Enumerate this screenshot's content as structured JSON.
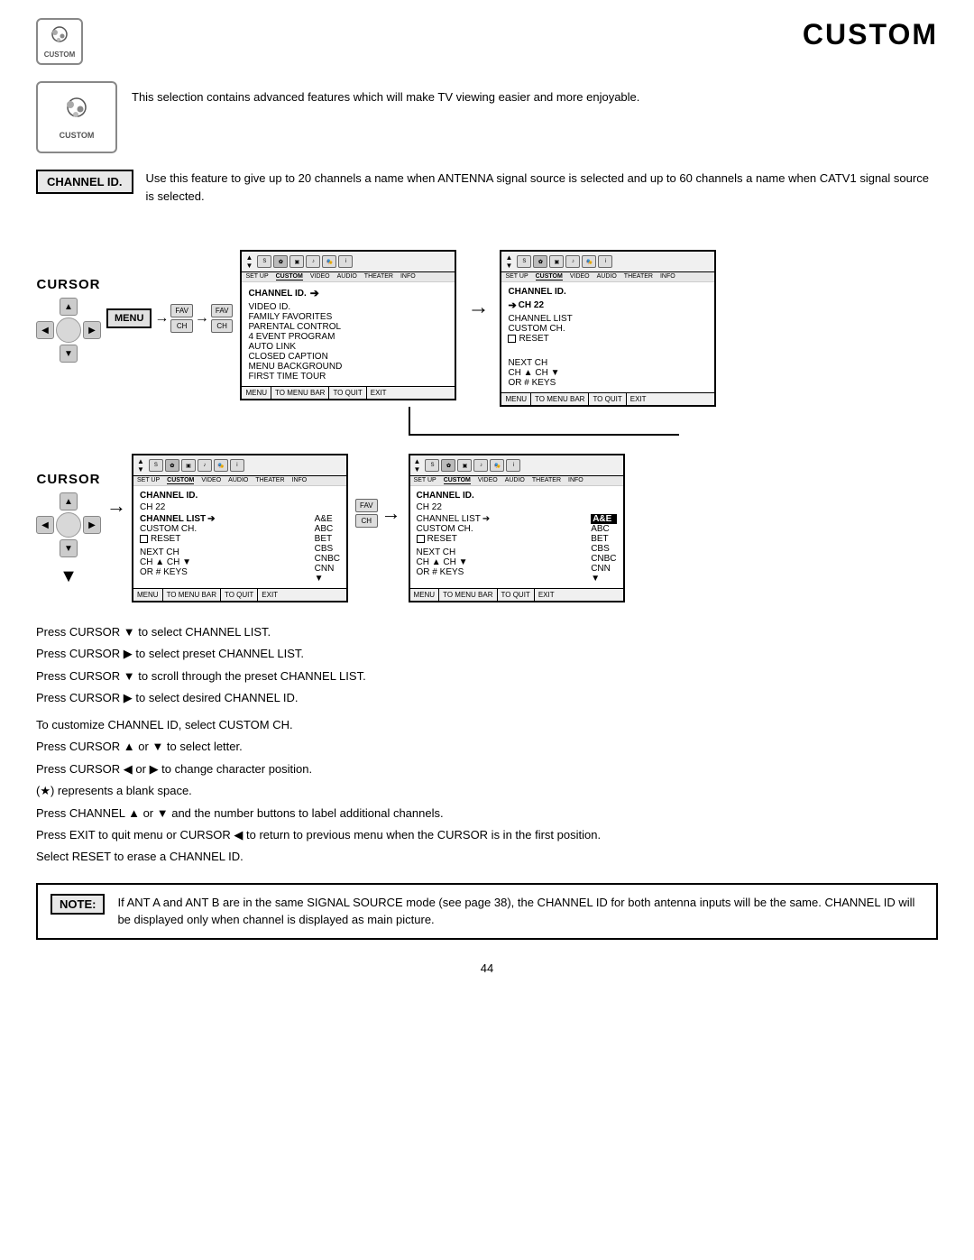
{
  "page": {
    "title": "CUSTOM",
    "number": "44"
  },
  "header_icon": {
    "label": "CUSTOM"
  },
  "intro": {
    "text": "This selection contains advanced features which will make TV viewing easier and more enjoyable.",
    "icon_label": "CUSTOM"
  },
  "channel_id": {
    "label": "CHANNEL ID.",
    "description": "Use this feature to give up to 20 channels a name when ANTENNA signal source is selected and up to 60 channels a name when CATV1 signal source is selected."
  },
  "screen1": {
    "tabs": [
      "SET UP",
      "CUSTOM",
      "VIDEO",
      "AUDIO",
      "THEATER",
      "INFO"
    ],
    "active_tab": "CUSTOM",
    "content_title": "CHANNEL ID.",
    "items": [
      "VIDEO ID.",
      "FAMILY FAVORITES",
      "PARENTAL CONTROL",
      "4 EVENT PROGRAM",
      "AUTO LINK",
      "CLOSED CAPTION",
      "MENU BACKGROUND",
      "FIRST TIME TOUR"
    ],
    "selected_item": "CHANNEL ID.",
    "footer": [
      "MENU",
      "TO MENU BAR",
      "TO QUIT",
      "EXIT"
    ]
  },
  "screen2": {
    "tabs": [
      "SET UP",
      "CUSTOM",
      "VIDEO",
      "AUDIO",
      "THEATER",
      "INFO"
    ],
    "active_tab": "CUSTOM",
    "content_title": "CHANNEL ID.",
    "ch_label": "▶ CH 22",
    "items": [
      "CHANNEL LIST",
      "CUSTOM CH.",
      "RESET",
      "",
      "NEXT CH",
      "CH ▲ CH ▼",
      "OR # KEYS"
    ],
    "footer": [
      "MENU",
      "TO MENU BAR",
      "TO QUIT",
      "EXIT"
    ]
  },
  "screen3": {
    "tabs": [
      "SET UP",
      "CUSTOM",
      "VIDEO",
      "AUDIO",
      "THEATER",
      "INFO"
    ],
    "active_tab": "CUSTOM",
    "content_title": "CHANNEL ID.",
    "ch22": "CH 22",
    "channel_list_label": "CHANNEL LIST ▶",
    "channel_list_selected": false,
    "custom_ch": "CUSTOM CH.",
    "has_reset": true,
    "next_ch": "NEXT CH",
    "ch_keys": "CH ▲ CH ▼",
    "or_keys": "OR # KEYS",
    "right_col": [
      "A&E",
      "ABC",
      "BET",
      "CBS",
      "CNBC",
      "CNN",
      "▼"
    ],
    "footer": [
      "MENU",
      "TO MENU BAR",
      "TO QUIT",
      "EXIT"
    ]
  },
  "screen4": {
    "tabs": [
      "SET UP",
      "CUSTOM",
      "VIDEO",
      "AUDIO",
      "THEATER",
      "INFO"
    ],
    "active_tab": "CUSTOM",
    "content_title": "CHANNEL ID.",
    "ch22": "CH 22",
    "channel_list_label": "CHANNEL LIST ▶",
    "custom_ch": "CUSTOM CH.",
    "has_reset": true,
    "next_ch": "NEXT CH",
    "ch_keys": "CH ▲ CH ▼",
    "or_keys": "OR # KEYS",
    "right_col_selected": "A&E",
    "right_col": [
      "A&E",
      "ABC",
      "BET",
      "CBS",
      "CNBC",
      "CNN",
      "▼"
    ],
    "footer": [
      "MENU",
      "TO MENU BAR",
      "TO QUIT",
      "EXIT"
    ]
  },
  "nav_labels": {
    "cursor": "CURSOR",
    "menu": "MENU"
  },
  "desc_lines": [
    "Press CURSOR ▼ to select CHANNEL LIST.",
    "Press CURSOR ▶ to select preset CHANNEL LIST.",
    "Press CURSOR ▼ to scroll through the preset CHANNEL LIST.",
    "Press CURSOR ▶ to select desired CHANNEL ID.",
    "",
    "To customize CHANNEL ID, select CUSTOM CH.",
    "Press CURSOR ▲ or ▼ to select letter.",
    "Press CURSOR ◀ or ▶ to change character position.",
    "(★) represents a blank space.",
    "Press CHANNEL ▲ or ▼  and the number buttons to label additional channels.",
    "Press EXIT to quit menu or CURSOR ◀ to return to previous menu when the CURSOR is in the first position.",
    "Select RESET to erase a CHANNEL ID."
  ],
  "note": {
    "label": "NOTE:",
    "text": "If ANT A and ANT B are in the same SIGNAL SOURCE mode (see page 38), the CHANNEL ID for both antenna inputs will be the same.   CHANNEL ID will be displayed only when channel is displayed as main picture."
  }
}
